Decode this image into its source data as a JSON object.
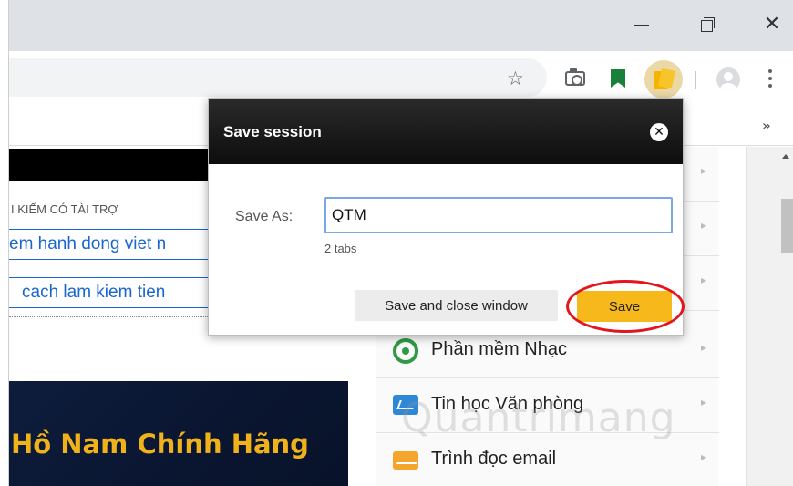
{
  "browser": {
    "window_controls": {
      "minimize": "",
      "maximize": "",
      "close": "✕"
    },
    "toolbar": {
      "overflow_chevrons": "»"
    }
  },
  "page": {
    "sponsored_label": "I KIẾM CÓ TÀI TRỢ",
    "ad_links": [
      "em hanh dong viet n",
      "cach lam kiem tien"
    ],
    "banner_text": "Hồ Nam Chính Hãng",
    "side_menu": [
      {
        "label": "Phần mềm Nhạc",
        "icon": "music-icon"
      },
      {
        "label": "Tin học Văn phòng",
        "icon": "office-icon"
      },
      {
        "label": "Trình đọc email",
        "icon": "email-icon"
      }
    ],
    "watermark": "Quantrimang"
  },
  "popup": {
    "title": "Save session",
    "close_glyph": "✕",
    "save_as_label": "Save As:",
    "name_value": "QTM",
    "tab_count": "2 tabs",
    "save_close_label": "Save and close window",
    "save_label": "Save"
  },
  "colors": {
    "accent_save": "#f7b81b",
    "highlight_ring": "#e3161e",
    "link_blue": "#1a66d0"
  }
}
